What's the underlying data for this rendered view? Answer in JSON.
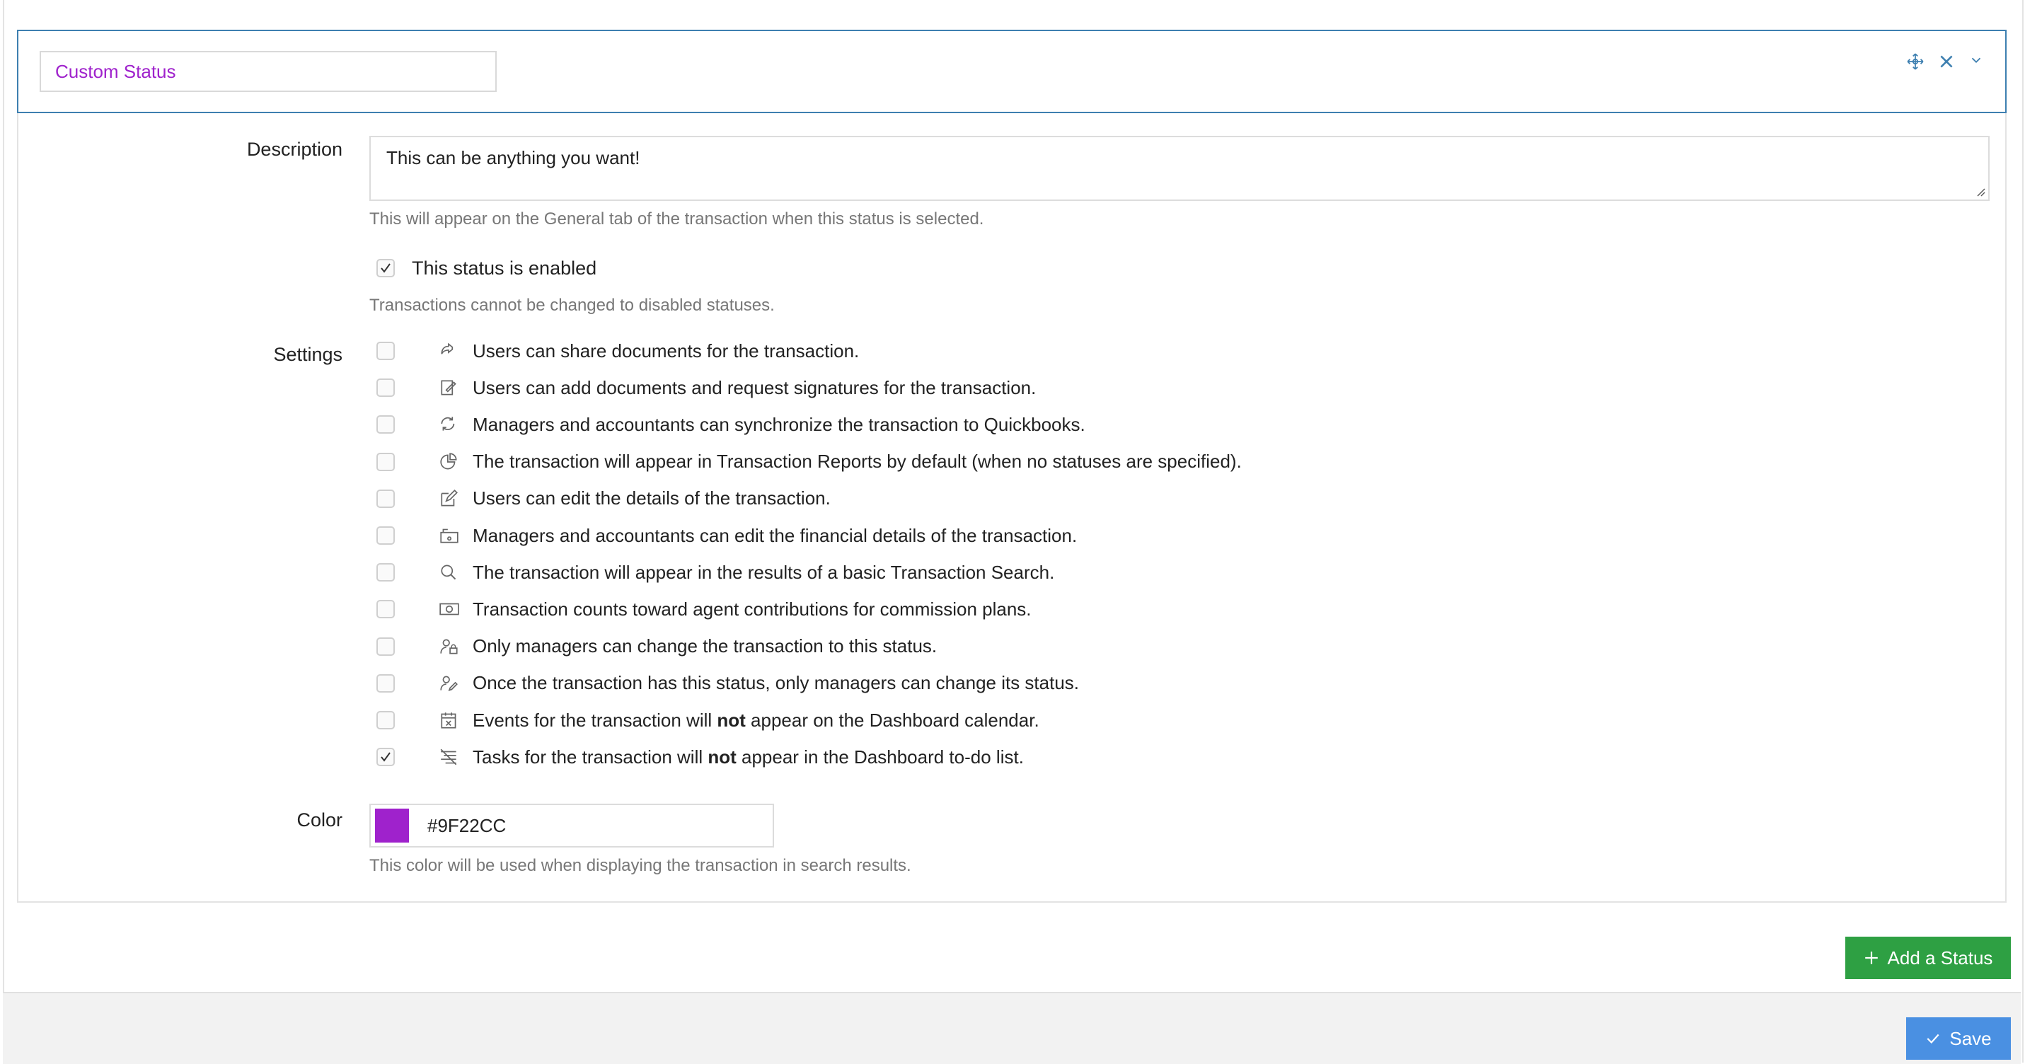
{
  "status": {
    "name": "Custom Status",
    "header_icons": [
      "move-icon",
      "close-icon",
      "chevron-down-icon"
    ]
  },
  "description": {
    "label": "Description",
    "value": "This can be anything you want!",
    "help": "This will appear on the General tab of the transaction when this status is selected."
  },
  "enabled": {
    "label": "This status is enabled",
    "checked": true,
    "help": "Transactions cannot be changed to disabled statuses."
  },
  "settings": {
    "label": "Settings",
    "items": [
      {
        "icon": "share-icon",
        "checked": false,
        "pre": "Users can share documents for the transaction.",
        "bold": "",
        "post": ""
      },
      {
        "icon": "signature-icon",
        "checked": false,
        "pre": "Users can add documents and request signatures for the transaction.",
        "bold": "",
        "post": ""
      },
      {
        "icon": "sync-icon",
        "checked": false,
        "pre": "Managers and accountants can synchronize the transaction to Quickbooks.",
        "bold": "",
        "post": ""
      },
      {
        "icon": "pie-chart-icon",
        "checked": false,
        "pre": "The transaction will appear in Transaction Reports by default (when no statuses are specified).",
        "bold": "",
        "post": ""
      },
      {
        "icon": "edit-icon",
        "checked": false,
        "pre": "Users can edit the details of the transaction.",
        "bold": "",
        "post": ""
      },
      {
        "icon": "financial-icon",
        "checked": false,
        "pre": "Managers and accountants can edit the financial details of the transaction.",
        "bold": "",
        "post": ""
      },
      {
        "icon": "search-icon",
        "checked": false,
        "pre": "The transaction will appear in the results of a basic Transaction Search.",
        "bold": "",
        "post": ""
      },
      {
        "icon": "money-icon",
        "checked": false,
        "pre": "Transaction counts toward agent contributions for commission plans.",
        "bold": "",
        "post": ""
      },
      {
        "icon": "user-lock-icon",
        "checked": false,
        "pre": "Only managers can change the transaction to this status.",
        "bold": "",
        "post": ""
      },
      {
        "icon": "user-edit-icon",
        "checked": false,
        "pre": "Once the transaction has this status, only managers can change its status.",
        "bold": "",
        "post": ""
      },
      {
        "icon": "calendar-x-icon",
        "checked": false,
        "pre": "Events for the transaction will ",
        "bold": "not",
        "post": " appear on the Dashboard calendar."
      },
      {
        "icon": "list-x-icon",
        "checked": true,
        "pre": "Tasks for the transaction will ",
        "bold": "not",
        "post": " appear in the Dashboard to-do list."
      }
    ]
  },
  "color": {
    "label": "Color",
    "value": "#9F22CC",
    "help": "This color will be used when displaying the transaction in search results."
  },
  "buttons": {
    "add_status": "Add a Status",
    "save": "Save"
  },
  "colors": {
    "accent_green": "#2ea043",
    "accent_blue": "#4a90e2",
    "header_border": "#3d7fb0",
    "status_purple": "#9F22CC"
  }
}
